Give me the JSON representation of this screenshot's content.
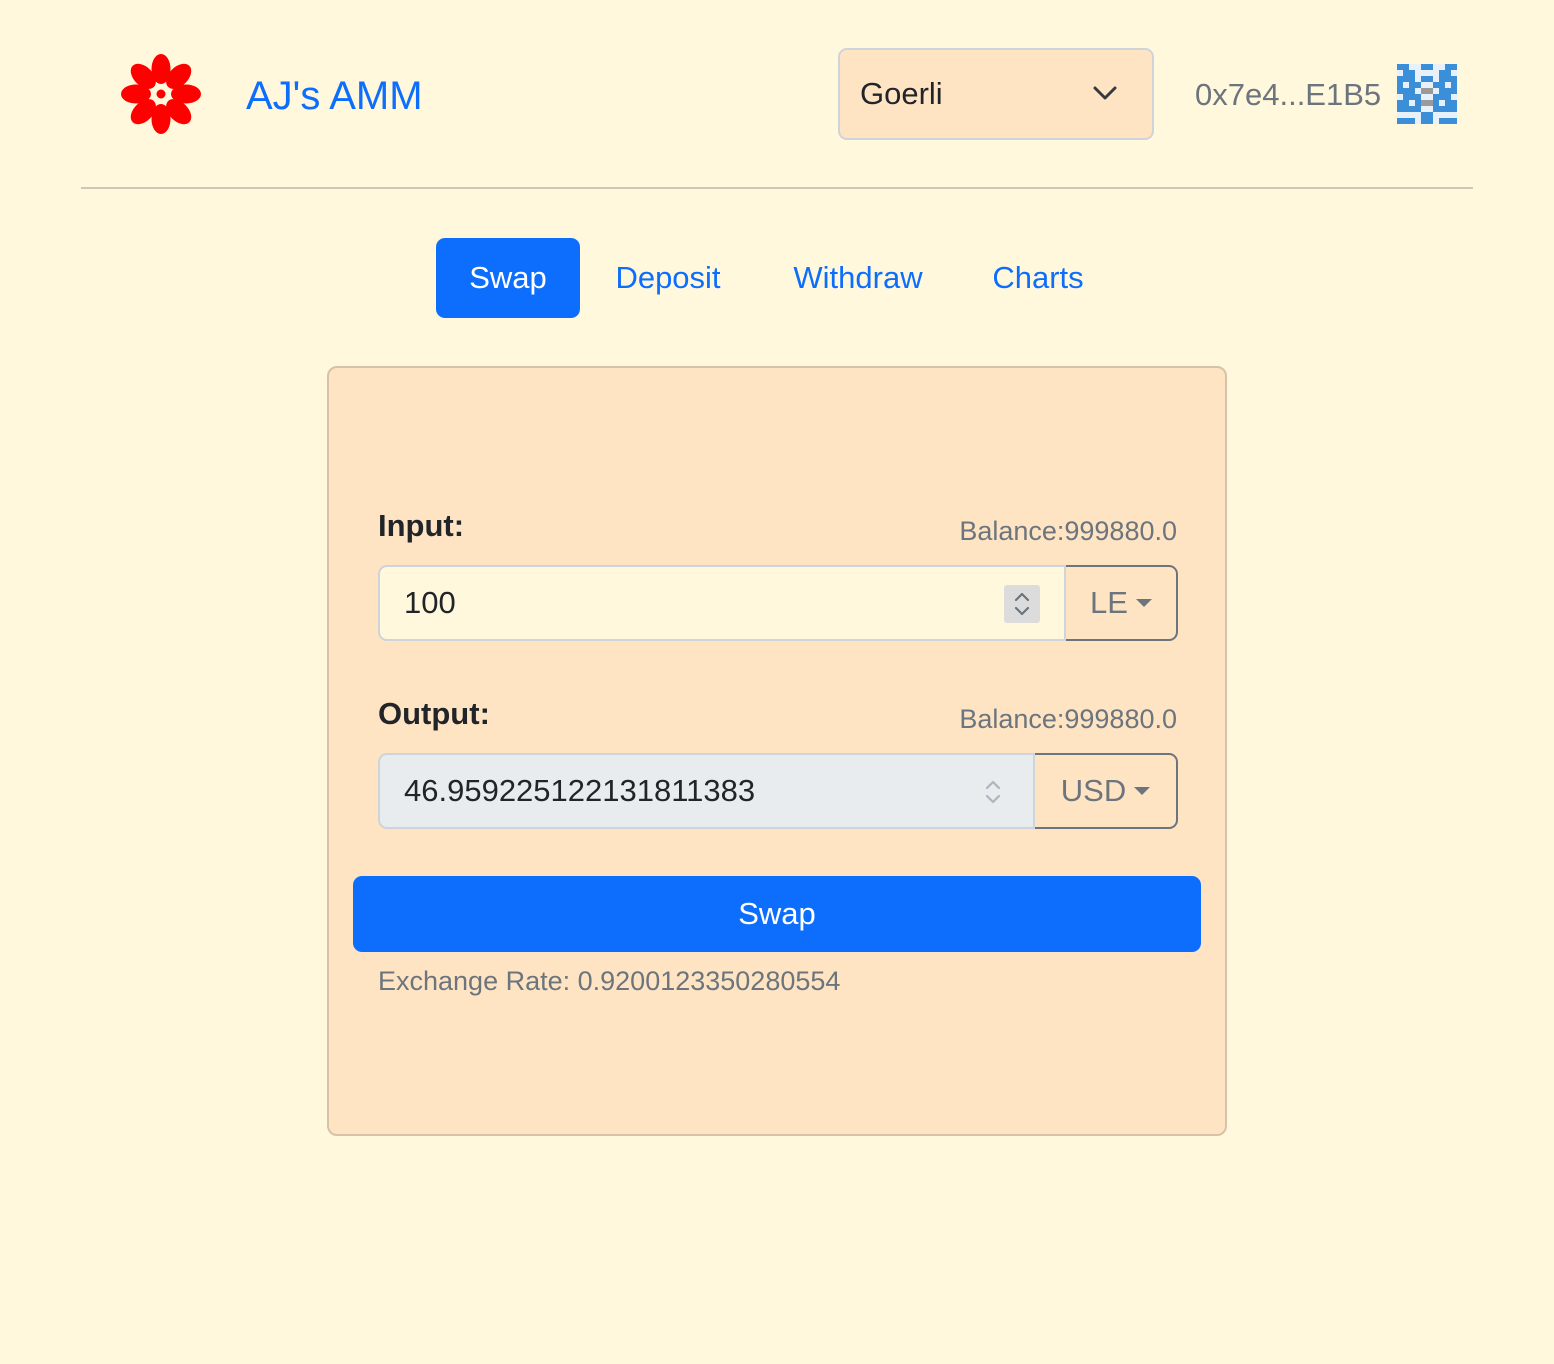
{
  "header": {
    "brand": "AJ's AMM",
    "logo_icon": "red-flower-icon",
    "network": {
      "selected": "Goerli"
    },
    "account": {
      "address": "0x7e4...E1B5",
      "avatar_icon": "identicon-avatar"
    }
  },
  "tabs": [
    {
      "label": "Swap",
      "active": true
    },
    {
      "label": "Deposit",
      "active": false
    },
    {
      "label": "Withdraw",
      "active": false
    },
    {
      "label": "Charts",
      "active": false
    }
  ],
  "swap_card": {
    "input": {
      "label": "Input:",
      "balance": "Balance:999880.0",
      "value": "100",
      "token": "LE"
    },
    "output": {
      "label": "Output:",
      "balance": "Balance:999880.0",
      "value": "46.959225122131811383",
      "token": "USD"
    },
    "swap_button": "Swap",
    "exchange_rate": "Exchange Rate: 0.9200123350280554"
  },
  "colors": {
    "background": "#fff8dc",
    "card": "#ffe4c4",
    "primary": "#0d6efd",
    "logo": "#ff0000",
    "identicon": "#3b8fd9"
  }
}
